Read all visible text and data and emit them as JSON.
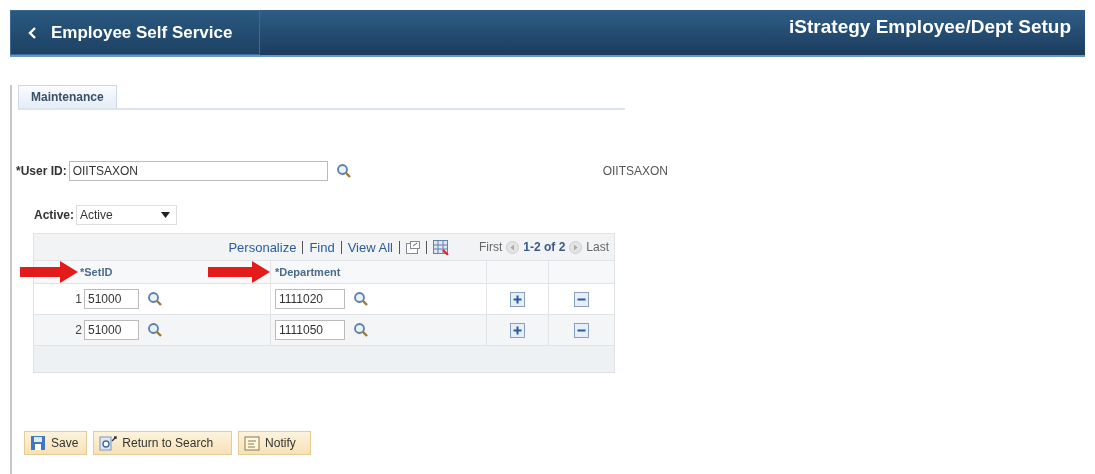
{
  "header": {
    "back_label": "Employee Self Service",
    "title": "iStrategy Employee/Dept Setup"
  },
  "tabs": [
    {
      "label": "Maintenance",
      "selected": true
    }
  ],
  "user_id": {
    "label": "*User ID:",
    "value": "OIITSAXON",
    "display": "OIITSAXON"
  },
  "active": {
    "label": "Active:",
    "value": "Active"
  },
  "grid": {
    "links": [
      "Personalize",
      "Find",
      "View All"
    ],
    "nav": {
      "first": "First",
      "range": "1-2 of 2",
      "last": "Last"
    },
    "columns": [
      "*SetID",
      "*Department"
    ],
    "rows": [
      {
        "num": "1",
        "setid": "51000",
        "department": "1111020"
      },
      {
        "num": "2",
        "setid": "51000",
        "department": "1111050"
      }
    ]
  },
  "buttons": [
    {
      "kind": "save",
      "label": "Save"
    },
    {
      "kind": "return",
      "label": "Return to Search"
    },
    {
      "kind": "notify",
      "label": "Notify"
    }
  ]
}
